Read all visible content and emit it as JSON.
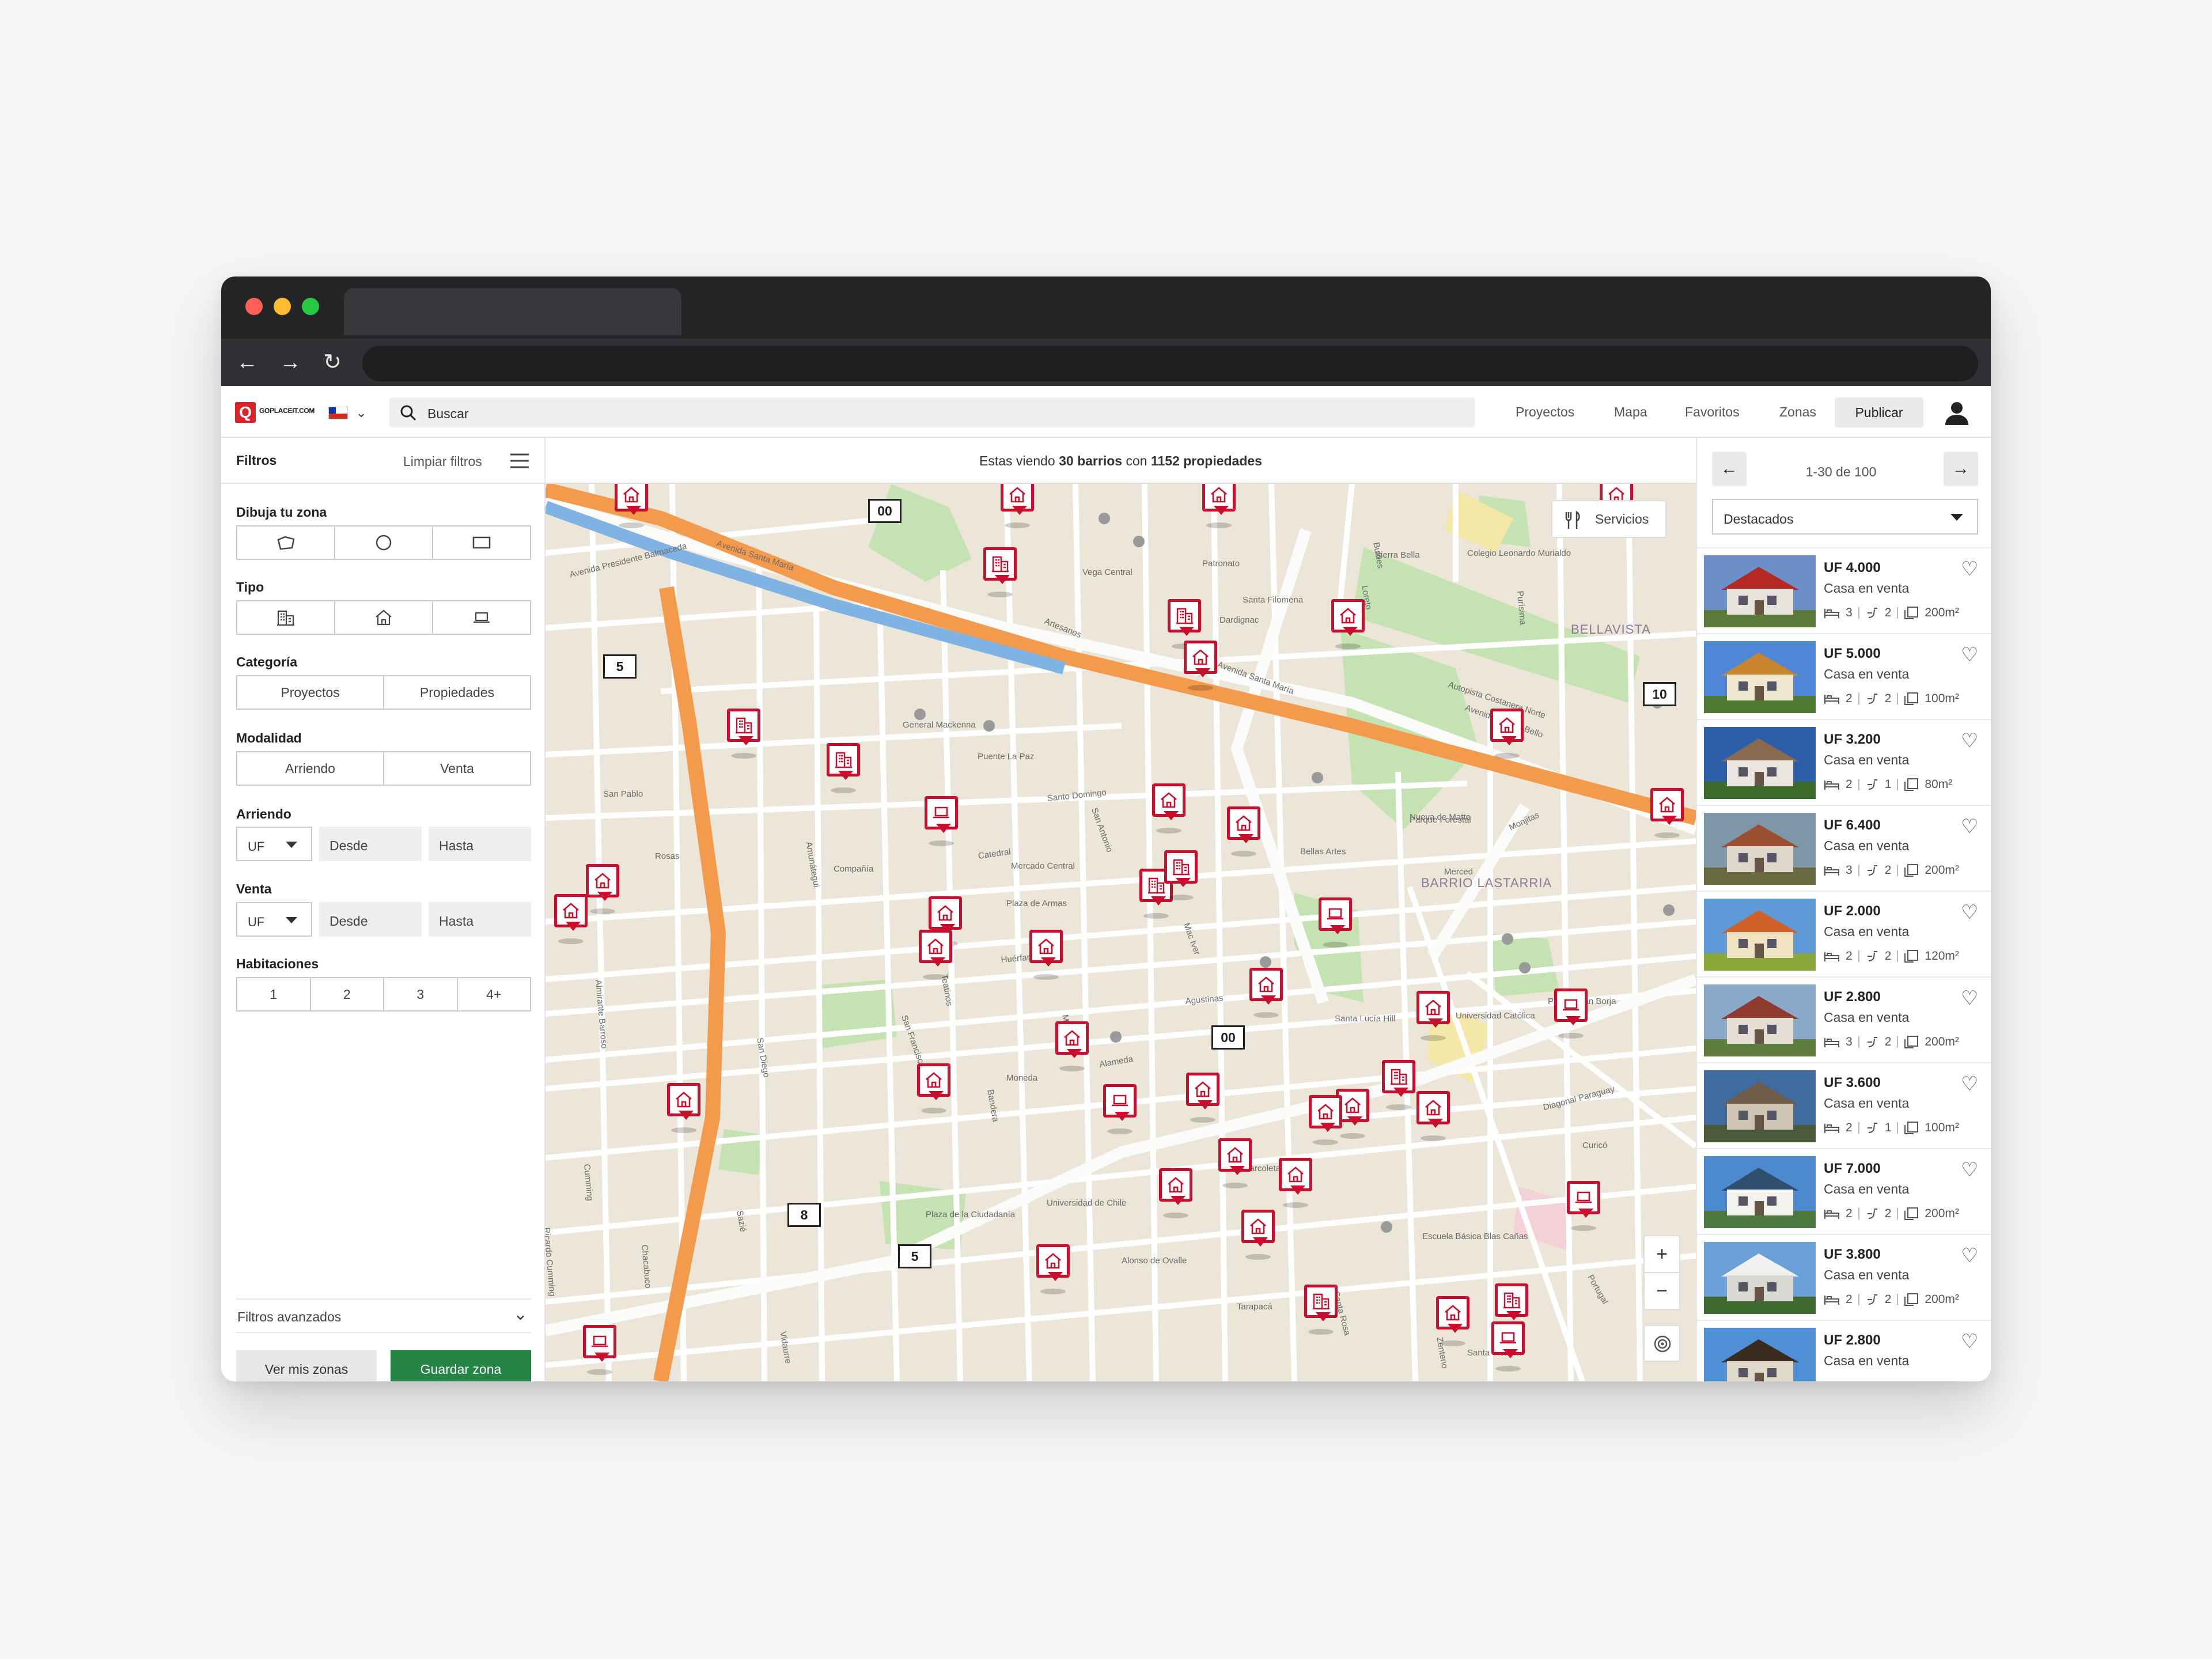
{
  "header": {
    "logo_letter": "Q",
    "logo_text": "GOPLACEIT.COM",
    "search_placeholder": "Buscar",
    "nav": [
      "Proyectos",
      "Mapa",
      "Favoritos",
      "Zonas"
    ],
    "publish": "Publicar"
  },
  "filters": {
    "title": "Filtros",
    "clear": "Limpiar filtros",
    "draw_zone": "Dibuja tu zona",
    "type": "Tipo",
    "category": "Categoría",
    "category_options": [
      "Proyectos",
      "Propiedades"
    ],
    "mode": "Modalidad",
    "mode_options": [
      "Arriendo",
      "Venta"
    ],
    "rent": "Arriendo",
    "sale": "Venta",
    "currency": "UF",
    "from": "Desde",
    "to": "Hasta",
    "rooms": "Habitaciones",
    "room_options": [
      "1",
      "2",
      "3",
      "4+"
    ],
    "advanced": "Filtros avanzados",
    "my_zones": "Ver mis zonas",
    "save_zone": "Guardar zona"
  },
  "map": {
    "info_prefix": "Estas viendo",
    "info_barrios": "30 barrios",
    "info_mid": "con",
    "info_props": "1152 propiedades",
    "services": "Servicios",
    "zoom_in": "+",
    "zoom_out": "−",
    "clusters": [
      "00",
      "5",
      "10",
      "00",
      "8",
      "5"
    ],
    "labels": [
      "Avenida Presidente Balmaceda",
      "Avenida Santa María",
      "Artesanos",
      "Avenida Santa María",
      "Autopista Costanera Norte",
      "Avenida Andrés Bello",
      "Merced",
      "Santo Domingo",
      "Catedral",
      "Monjitas",
      "Huérfanos",
      "Agustinas",
      "Moneda",
      "Alameda",
      "San Pablo",
      "Rosas",
      "Compañía",
      "Plaza de Armas",
      "BARRIO LASTARRIA",
      "BELLAVISTA",
      "Parque Forestal",
      "Bellas Artes",
      "Vega Central",
      "Colegio Leonardo Murialdo",
      "Mercado Central",
      "Puente La Paz",
      "General Mackenna",
      "Santa Lucía Hill",
      "Universidad Católica",
      "Parque San Borja",
      "Plaza de la Ciudadanía",
      "Universidad de Chile",
      "Escuela Básica Blas Cañas",
      "Alonso de Ovalle",
      "Tarapacá",
      "Santa Victoria",
      "Diagonal Paraguay",
      "Curicó",
      "Marcoleta",
      "Portugal",
      "San Antonio",
      "Mac Iver",
      "Santa Rosa",
      "San Francisco",
      "Zenteno",
      "San Diego",
      "Vidaurre",
      "Sazié",
      "Amunátegui",
      "Teatinos",
      "Bandera",
      "Morandé",
      "Almirante Barroso",
      "Cumming",
      "Ricardo Cumming",
      "Chacabuco",
      "Bulnes",
      "Santa Filomena",
      "Dardignac",
      "Loreto",
      "Purísima",
      "Patronato",
      "Nueva de Matte",
      "Sierra Bella"
    ]
  },
  "results": {
    "pager": "1-30 de 100",
    "sort": "Destacados",
    "items": [
      {
        "price": "UF 4.000",
        "type": "Casa en venta",
        "beds": "3",
        "baths": "2",
        "area": "200m²"
      },
      {
        "price": "UF 5.000",
        "type": "Casa en venta",
        "beds": "2",
        "baths": "2",
        "area": "100m²"
      },
      {
        "price": "UF 3.200",
        "type": "Casa en venta",
        "beds": "2",
        "baths": "1",
        "area": "80m²"
      },
      {
        "price": "UF 6.400",
        "type": "Casa en venta",
        "beds": "3",
        "baths": "2",
        "area": "200m²"
      },
      {
        "price": "UF 2.000",
        "type": "Casa en venta",
        "beds": "2",
        "baths": "2",
        "area": "120m²"
      },
      {
        "price": "UF 2.800",
        "type": "Casa en venta",
        "beds": "3",
        "baths": "2",
        "area": "200m²"
      },
      {
        "price": "UF 3.600",
        "type": "Casa en venta",
        "beds": "2",
        "baths": "1",
        "area": "100m²"
      },
      {
        "price": "UF 7.000",
        "type": "Casa en venta",
        "beds": "2",
        "baths": "2",
        "area": "200m²"
      },
      {
        "price": "UF 3.800",
        "type": "Casa en venta",
        "beds": "2",
        "baths": "2",
        "area": "200m²"
      },
      {
        "price": "UF 2.800",
        "type": "Casa en venta",
        "beds": "",
        "baths": "",
        "area": ""
      }
    ]
  },
  "colors": {
    "brand": "#d9252a",
    "pin": "#c8102e",
    "green": "#238443",
    "map_bg": "#ece6d9",
    "park": "#c5e3b2",
    "highway": "#f39a4c",
    "river": "#7fb3e3"
  },
  "icons": [
    "search-icon",
    "chevron-down-icon",
    "user-icon",
    "hamburger-icon",
    "polygon-icon",
    "circle-icon",
    "square-icon",
    "building-icon",
    "house-icon",
    "laptop-icon",
    "fork-knife-icon",
    "locate-icon",
    "heart-icon",
    "bed-icon",
    "bath-icon",
    "area-icon",
    "arrow-left-icon",
    "arrow-right-icon"
  ]
}
